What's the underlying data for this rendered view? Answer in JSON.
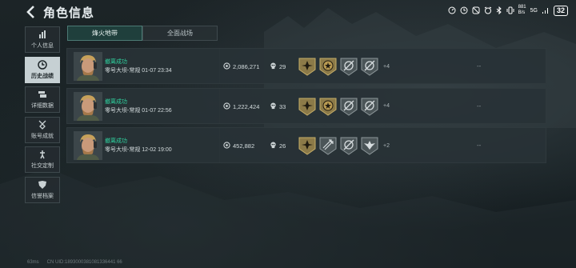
{
  "header": {
    "title": "角色信息"
  },
  "status_bar": {
    "net_speed_value": "881",
    "net_speed_unit": "B/s",
    "network": "5G",
    "battery": "32"
  },
  "sidebar": {
    "items": [
      {
        "label": "个人信息",
        "icon": "bar-chart-icon",
        "active": false
      },
      {
        "label": "历史战绩",
        "icon": "clock-icon",
        "active": true
      },
      {
        "label": "详细数据",
        "icon": "stack-icon",
        "active": false
      },
      {
        "label": "账号成就",
        "icon": "medal-icon",
        "active": false
      },
      {
        "label": "社交定制",
        "icon": "wrench-icon",
        "active": false
      },
      {
        "label": "信誉档案",
        "icon": "shield-icon",
        "active": false
      }
    ]
  },
  "tabs": [
    {
      "label": "烽火地带",
      "active": true
    },
    {
      "label": "全面战场",
      "active": false
    }
  ],
  "matches": [
    {
      "result": "撤离成功",
      "map_info": "零号大坝-常规 01-07 23:34",
      "value": "2,086,271",
      "kills": "29",
      "badges": [
        "gold-compass-badge",
        "gold-star-badge",
        "silver-target-badge",
        "silver-target-badge"
      ],
      "more": "+4",
      "extra": "--"
    },
    {
      "result": "撤离成功",
      "map_info": "零号大坝-常规 01-07 22:56",
      "value": "1,222,424",
      "kills": "33",
      "badges": [
        "gold-compass-badge",
        "gold-star-badge",
        "silver-target-badge",
        "silver-target-badge"
      ],
      "more": "+4",
      "extra": "--"
    },
    {
      "result": "撤离成功",
      "map_info": "零号大坝-常规 12-02 19:00",
      "value": "452,882",
      "kills": "26",
      "badges": [
        "gold-compass-badge",
        "silver-arrows-badge",
        "silver-target-badge",
        "silver-wing-badge"
      ],
      "more": "+2",
      "extra": "--"
    }
  ],
  "footer": {
    "fps": "63ms",
    "uid": "CN UID:1893000381081336441 66"
  },
  "colors": {
    "accent": "#2fd4a0",
    "tab_active": "#1f3f3c",
    "sidebar_active": "#c6d0d3",
    "gold": "#b89a52",
    "silver": "#7d878a"
  }
}
